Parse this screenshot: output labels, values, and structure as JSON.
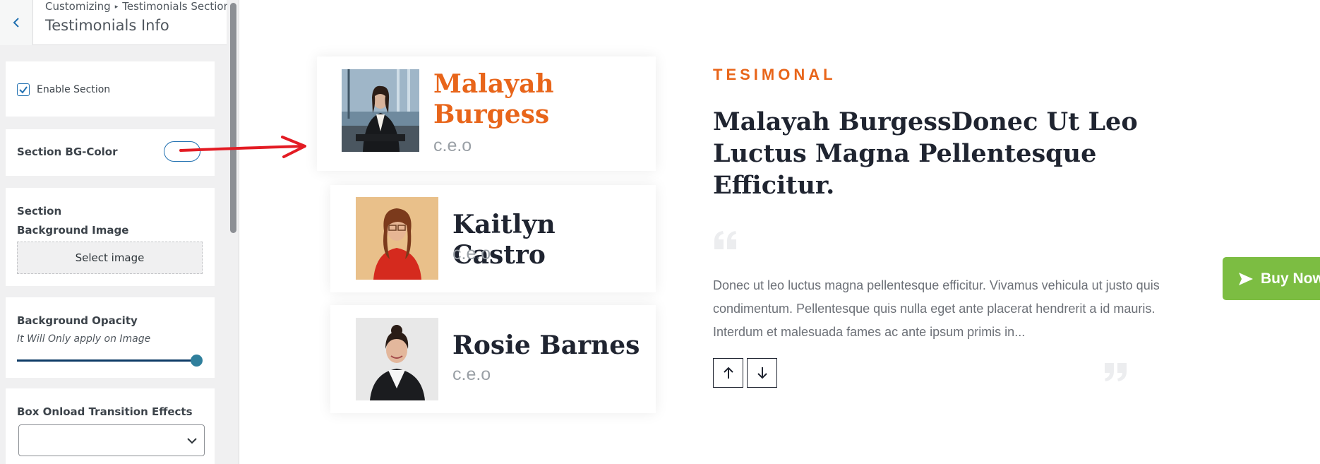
{
  "sidebar": {
    "breadcrumb": {
      "root": "Customizing",
      "section": "Testimonials Section"
    },
    "title": "Testimonials Info",
    "enable_section": {
      "label": "Enable Section",
      "checked": true
    },
    "bg_color": {
      "label": "Section BG-Color"
    },
    "bg_image": {
      "label": "Section Background Image",
      "button": "Select image"
    },
    "opacity": {
      "label": "Background Opacity",
      "description": "It Will Only apply on Image",
      "value": 1.0
    },
    "transition": {
      "label": "Box Onload Transition Effects",
      "value": ""
    }
  },
  "preview": {
    "testimonials": [
      {
        "name": "Malayah Burgess",
        "role": "c.e.o",
        "active": true
      },
      {
        "name": "Kaitlyn Castro",
        "role": "c.e.o",
        "active": false
      },
      {
        "name": "Rosie Barnes",
        "role": "c.e.o",
        "active": false
      }
    ],
    "eyebrow": "TESIMONAL",
    "headline": "Malayah BurgessDonec Ut Leo Luctus Magna Pellentesque Efficitur.",
    "body": "Donec ut leo luctus magna pellentesque efficitur. Vivamus vehicula ut justo quis condimentum. Pellentesque quis nulla eget ante placerat hendrerit a id mauris. Interdum et malesuada fames ac ante ipsum primis in...",
    "buy_now": "Buy Now"
  },
  "colors": {
    "accent": "#e8651a",
    "heading": "#1f2430",
    "buy_now_bg": "#7cbd42",
    "annotation": "#e31b23"
  }
}
